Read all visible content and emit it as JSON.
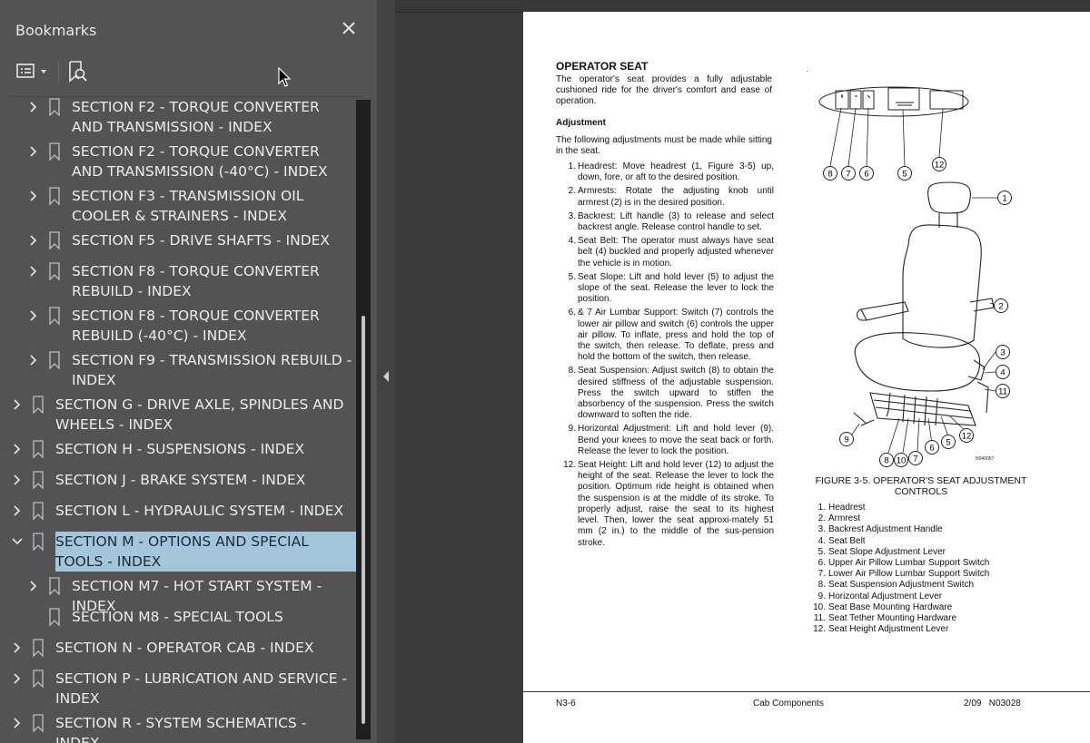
{
  "sidebar": {
    "title": "Bookmarks",
    "items": [
      {
        "level": 2,
        "expanded": false,
        "label": "SECTION F2 - TORQUE CONVERTER AND TRANSMISSION - INDEX"
      },
      {
        "level": 2,
        "expanded": false,
        "label": "SECTION F2 - TORQUE CONVERTER AND TRANSMISSION (-40°C) - INDEX"
      },
      {
        "level": 2,
        "expanded": false,
        "label": "SECTION F3 - TRANSMISSION OIL COOLER & STRAINERS - INDEX"
      },
      {
        "level": 2,
        "expanded": false,
        "label": "SECTION F5 - DRIVE SHAFTS - INDEX"
      },
      {
        "level": 2,
        "expanded": false,
        "label": "SECTION F8 - TORQUE CONVERTER REBUILD - INDEX"
      },
      {
        "level": 2,
        "expanded": false,
        "label": "SECTION F8 - TORQUE CONVERTER REBUILD (-40°C) - INDEX"
      },
      {
        "level": 2,
        "expanded": false,
        "label": "SECTION F9 - TRANSMISSION REBUILD - INDEX"
      },
      {
        "level": 1,
        "expanded": false,
        "label": "SECTION G - DRIVE AXLE, SPINDLES AND WHEELS - INDEX"
      },
      {
        "level": 1,
        "expanded": false,
        "label": "SECTION H - SUSPENSIONS - INDEX"
      },
      {
        "level": 1,
        "expanded": false,
        "label": "SECTION J - BRAKE SYSTEM - INDEX"
      },
      {
        "level": 1,
        "expanded": false,
        "label": "SECTION L - HYDRAULIC SYSTEM -  INDEX"
      },
      {
        "level": 1,
        "expanded": true,
        "selected": true,
        "label": "SECTION M - OPTIONS AND SPECIAL TOOLS - INDEX"
      },
      {
        "level": 2,
        "expanded": false,
        "label": "SECTION M7 - HOT START SYSTEM -  INDEX"
      },
      {
        "level": 2,
        "leaf": true,
        "label": "SECTION  M8 -  SPECIAL TOOLS"
      },
      {
        "level": 1,
        "expanded": false,
        "label": "SECTION N - OPERATOR CAB - INDEX"
      },
      {
        "level": 1,
        "expanded": false,
        "label": "SECTION P - LUBRICATION AND SERVICE - INDEX"
      },
      {
        "level": 1,
        "expanded": false,
        "label": "SECTION R - SYSTEM SCHEMATICS - INDEX"
      }
    ]
  },
  "document": {
    "heading": "OPERATOR SEAT",
    "intro": "The operator's seat provides a fully adjustable cushioned ride for the driver's comfort and ease of operation.",
    "subheading": "Adjustment",
    "lead": "The following adjustments must be made while sitting in the seat.",
    "steps": [
      {
        "n": "1.",
        "text": "Headrest: Move headrest (1, Figure 3-5) up, down, fore, or aft to the desired position."
      },
      {
        "n": "2.",
        "text": "Armrests: Rotate the adjusting knob until armrest (2) is in the desired position."
      },
      {
        "n": "3.",
        "text": "Backrest: Lift handle (3) to release and select backrest angle. Release control handle to set."
      },
      {
        "n": "4.",
        "text": "Seat Belt: The operator must always have seat belt (4) buckled and properly adjusted whenever the vehicle is in motion."
      },
      {
        "n": "5.",
        "text": "Seat Slope: Lift and hold lever (5) to adjust the slope of the seat. Release the lever to lock the position."
      },
      {
        "n": "6.",
        "text": "& 7 Air Lumbar Support: Switch (7) controls the lower air pillow and switch (6) controls the upper air pillow. To inflate, press and hold the top of the switch, then release. To deflate, press and hold the bottom of the switch, then release."
      },
      {
        "n": "8.",
        "text": "Seat Suspension: Adjust switch (8) to obtain the desired stiffness of the adjustable suspension. Press the switch upward to stiffen the absorbency of the suspension. Press the switch downward to soften the ride."
      },
      {
        "n": "9.",
        "text": "Horizontal Adjustment: Lift and hold lever (9). Bend your knees to move the seat back or forth. Release the lever to lock the position."
      },
      {
        "n": "12.",
        "text": "Seat Height: Lift and hold lever (12) to adjust the height of the seat. Release the lever to lock the position. Optimum ride height is obtained when the suspension is at the middle of its stroke. To properly adjust, raise the seat to its highest level. Then, lower the seat approxi-mately 51 mm (2 in.) to the middle of the sus-pension stroke."
      }
    ],
    "figure_caption": "FIGURE 3-5. OPERATOR'S SEAT ADJUSTMENT CONTROLS",
    "figure_code": "N040057",
    "legend": [
      {
        "n": "1.",
        "text": "Headrest"
      },
      {
        "n": "2.",
        "text": "Armrest"
      },
      {
        "n": "3.",
        "text": "Backrest Adjustment Handle"
      },
      {
        "n": "4.",
        "text": "Seat Belt"
      },
      {
        "n": "5.",
        "text": "Seat Slope Adjustment Lever"
      },
      {
        "n": "6.",
        "text": "Upper Air Pillow Lumbar Support Switch"
      },
      {
        "n": "7.",
        "text": "Lower Air Pillow Lumbar Support Switch"
      },
      {
        "n": "8.",
        "text": "Seat Suspension Adjustment Switch"
      },
      {
        "n": "9.",
        "text": "Horizontal Adjustment Lever"
      },
      {
        "n": "10.",
        "text": "Seat Base Mounting Hardware"
      },
      {
        "n": "11.",
        "text": "Seat Tether Mounting Hardware"
      },
      {
        "n": "12.",
        "text": "Seat Height Adjustment Lever"
      }
    ],
    "footer": {
      "left": "N3-6",
      "center": "Cab Components",
      "right": "2/09   N03028"
    },
    "callouts": [
      "1",
      "2",
      "3",
      "4",
      "5",
      "6",
      "7",
      "8",
      "9",
      "10",
      "11",
      "12"
    ]
  },
  "colors": {
    "panel": "#535353",
    "selection": "#a3c6dd",
    "page": "#ffffff",
    "background": "#3b3b3b"
  }
}
